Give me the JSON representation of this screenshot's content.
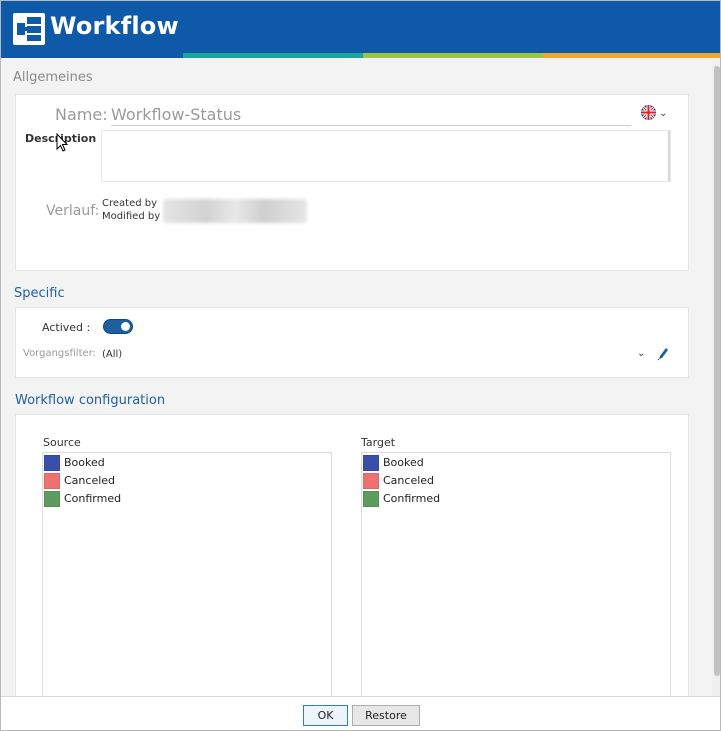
{
  "app": {
    "title": "Workflow"
  },
  "colors": {
    "header": "#0e5aa8",
    "stripe": [
      "#0e5aa8",
      "#1aa69a",
      "#9bc645",
      "#f0a630"
    ],
    "section_blue": "#1f5f9e",
    "section_gray": "#8a8a8a",
    "toggle": "#1f5f9e"
  },
  "general": {
    "title": "Allgemeines",
    "name_label": "Name:",
    "name_value": "Workflow-Status",
    "flag_icon": "uk-flag-icon",
    "description_label": "Description :",
    "description_value": "",
    "history_label": "Verlauf:",
    "created_by": "Created by",
    "modified_by": "Modified by"
  },
  "specific": {
    "title": "Specific",
    "actived_label": "Actived :",
    "actived": true,
    "filter_label": "Vorgangsfilter:",
    "filter_value": "(All)"
  },
  "workflow_config": {
    "title": "Workflow configuration",
    "source_label": "Source",
    "target_label": "Target",
    "source_items": [
      {
        "label": "Booked",
        "color": "#3a4fa8"
      },
      {
        "label": "Canceled",
        "color": "#ee7070"
      },
      {
        "label": "Confirmed",
        "color": "#5e9b5e"
      }
    ],
    "target_items": [
      {
        "label": "Booked",
        "color": "#3a4fa8"
      },
      {
        "label": "Canceled",
        "color": "#ee7070"
      },
      {
        "label": "Confirmed",
        "color": "#5e9b5e"
      }
    ]
  },
  "footer": {
    "ok_label": "OK",
    "restore_label": "Restore"
  }
}
